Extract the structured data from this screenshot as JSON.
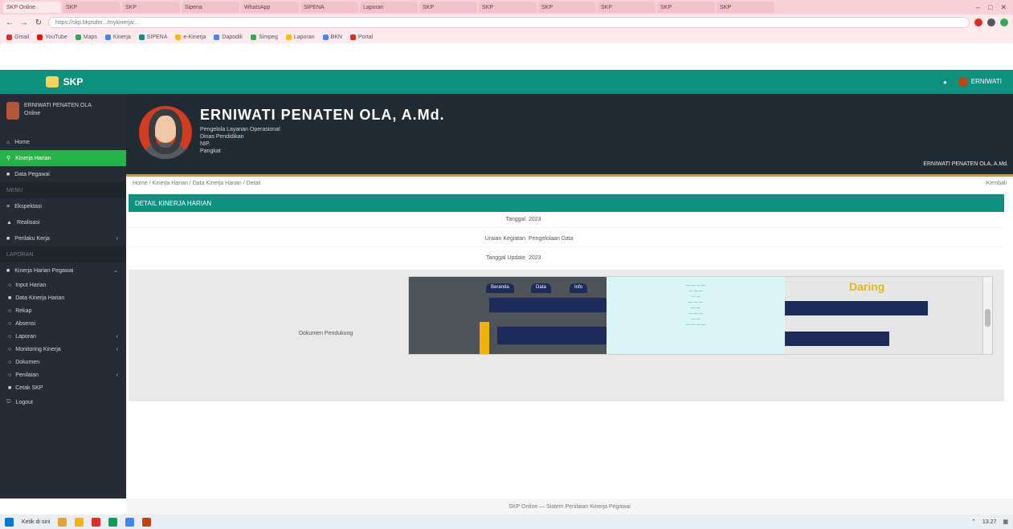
{
  "browser": {
    "tabs": [
      {
        "label": "SKP Online"
      },
      {
        "label": "SKP"
      },
      {
        "label": "SKP"
      },
      {
        "label": "Sipena"
      },
      {
        "label": "WhatsApp"
      },
      {
        "label": "SIPENA"
      },
      {
        "label": "Laporan"
      },
      {
        "label": "SKP"
      },
      {
        "label": "SKP"
      },
      {
        "label": "SKP"
      },
      {
        "label": "SKP"
      },
      {
        "label": "SKP"
      },
      {
        "label": "SKP"
      }
    ],
    "url": "https://skp.bkpsdm.../mykinerja/..."
  },
  "bookmarks": [
    {
      "label": "Gmail",
      "color": "#d93025"
    },
    {
      "label": "YouTube",
      "color": "#ff0000"
    },
    {
      "label": "Maps",
      "color": "#34a853"
    },
    {
      "label": "Kinerja",
      "color": "#4285f4"
    },
    {
      "label": "SIPENA",
      "color": "#0f8f80"
    },
    {
      "label": "e-Kinerja",
      "color": "#fbbc04"
    },
    {
      "label": "Dapodik",
      "color": "#4285f4"
    },
    {
      "label": "Simpeg",
      "color": "#34a853"
    },
    {
      "label": "Laporan",
      "color": "#fbbc04"
    },
    {
      "label": "BKN",
      "color": "#4285f4"
    },
    {
      "label": "Portal",
      "color": "#d93025"
    }
  ],
  "app": {
    "brand": "SKP",
    "user_label": "ERNIWATI"
  },
  "sidebar": {
    "user_name": "ERNIWATI PENATEN OLA",
    "user_sub": "Online",
    "items": [
      {
        "label": "Home",
        "active": false
      },
      {
        "label": "Kinerja Harian",
        "active": true
      },
      {
        "label": "Data Pegawai",
        "active": false
      }
    ],
    "section": "MENU",
    "items2": [
      {
        "label": "Ekspektasi"
      },
      {
        "label": "Realisasi"
      },
      {
        "label": "Perilaku Kerja"
      }
    ],
    "section2": "LAPORAN",
    "group": "Kinerja Harian Pegawai",
    "subitems": [
      {
        "label": "Input Harian"
      },
      {
        "label": "Data Kinerja Harian"
      },
      {
        "label": "Rekap"
      },
      {
        "label": "Absensi"
      },
      {
        "label": "Laporan"
      },
      {
        "label": "Monitoring Kinerja"
      },
      {
        "label": "Dokumen"
      },
      {
        "label": "Penilaian"
      },
      {
        "label": "Cetak SKP"
      }
    ],
    "logout": "Logout"
  },
  "profile": {
    "name": "ERNIWATI PENATEN OLA, A.Md.",
    "line1": "Pengelola Layanan Operasional",
    "line2": "Dinas Pendidikan",
    "line3": "NIP.",
    "line4": "Pangkat",
    "right_info": "ERNIWATI PENATEN OLA, A.Md."
  },
  "breadcrumb": {
    "text": "Home / Kinerja Harian / Data Kinerja Harian / Detail",
    "right": "Kembali"
  },
  "card": {
    "title": "DETAIL KINERJA HARIAN",
    "rows": [
      {
        "label": "Tanggal",
        "value": "2023"
      },
      {
        "label": "Uraian Kegiatan",
        "value": "Pengelolaan Data"
      },
      {
        "label": "Tanggal Update",
        "value": "2023"
      }
    ],
    "preview_label": "Dokumen Pendukung",
    "preview_brand": "Daring",
    "preview_tabs": [
      "Beranda",
      "Data",
      "Info"
    ]
  },
  "footer": {
    "text": "SKP Online — Sistem Penilaian Kinerja Pegawai"
  },
  "taskbar": {
    "search": "Ketik di sini",
    "time": "13.27"
  }
}
